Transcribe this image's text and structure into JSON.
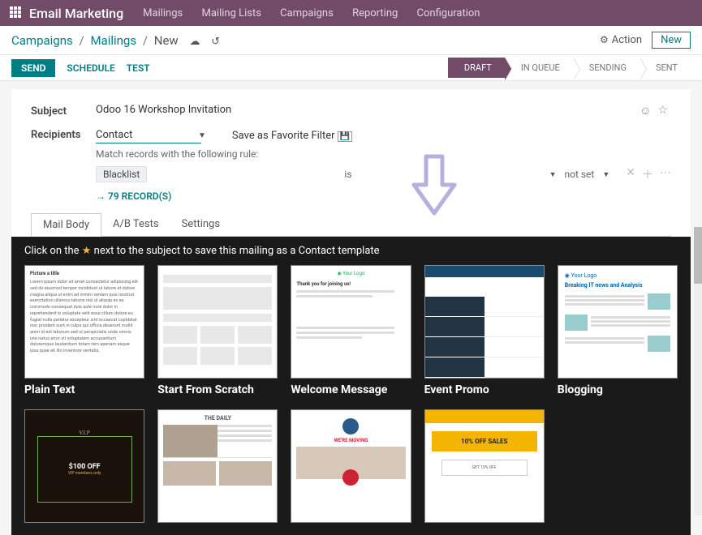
{
  "topbar": {
    "app_title": "Email Marketing",
    "menu": [
      "Mailings",
      "Mailing Lists",
      "Campaigns",
      "Reporting",
      "Configuration"
    ]
  },
  "breadcrumb": {
    "items": [
      "Campaigns",
      "Mailings",
      "New"
    ]
  },
  "actions": {
    "action_label": "Action",
    "new_label": "New"
  },
  "statusbar": {
    "send": "SEND",
    "schedule": "SCHEDULE",
    "test": "TEST",
    "stages": [
      "DRAFT",
      "IN QUEUE",
      "SENDING",
      "SENT"
    ],
    "active_stage": 0
  },
  "form": {
    "subject_label": "Subject",
    "subject_value": "Odoo 16 Workshop Invitation",
    "recipients_label": "Recipients",
    "recipients_value": "Contact",
    "save_filter_label": "Save as Favorite Filter",
    "match_rule_text": "Match records with the following rule:",
    "filter_field": "Blacklist",
    "filter_op": "is",
    "filter_val": "not set",
    "records_label": "79 RECORD(S)"
  },
  "tabs": {
    "items": [
      "Mail Body",
      "A/B Tests",
      "Settings"
    ],
    "active": 0
  },
  "templates": {
    "tip_prefix": "Click on the ",
    "tip_suffix": " next to the subject to save this mailing as a Contact template",
    "items": [
      "Plain Text",
      "Start From Scratch",
      "Welcome Message",
      "Event Promo",
      "Blogging"
    ],
    "row2_visible": true
  },
  "thumb_text": {
    "plain_heading": "Picture a title",
    "welcome_logo": "◉ Your Logo",
    "welcome_msg": "Thank you for joining us!",
    "blog_logo": "◉ Your Logo",
    "blog_headline": "Breaking IT news and Analysis",
    "vip_title": "V.I.P",
    "vip_off": "$100 OFF",
    "vip_sub": "VIP members only",
    "daily_title": "THE DAILY",
    "move_title": "WE'RE MOVING",
    "off_main": "10% OFF SALES",
    "off_sub": "GET 10% OFF"
  }
}
